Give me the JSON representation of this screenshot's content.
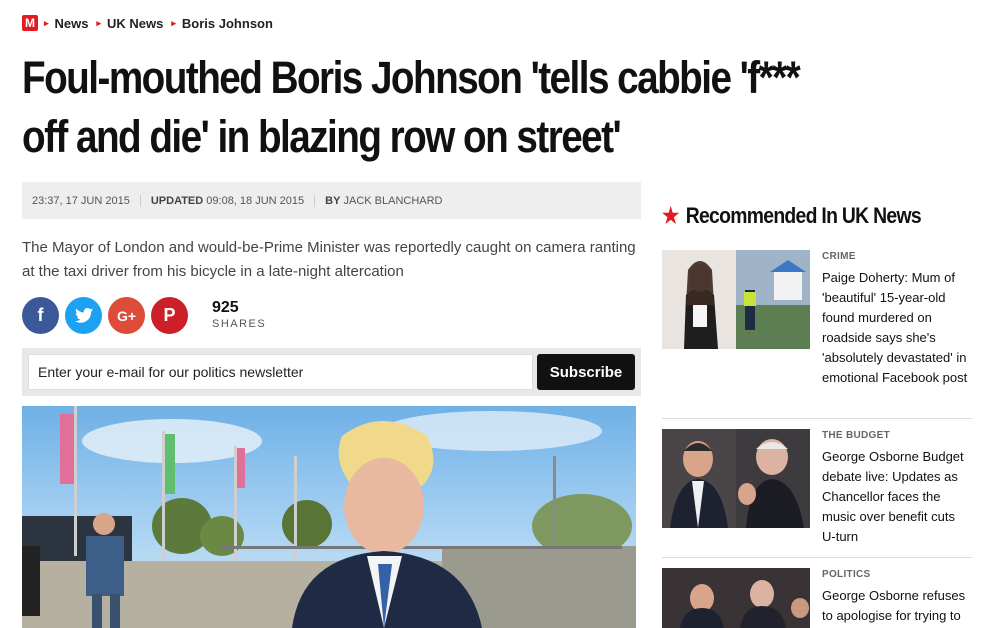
{
  "breadcrumb": {
    "logo": "M",
    "items": [
      "News",
      "UK News",
      "Boris Johnson"
    ]
  },
  "headline": "Foul-mouthed Boris Johnson 'tells cabbie 'f*** off and die' in blazing row on street'",
  "meta": {
    "published": "23:37, 17 JUN 2015",
    "updated_label": "UPDATED",
    "updated": "09:08, 18 JUN 2015",
    "by_label": "BY",
    "author": "JACK BLANCHARD"
  },
  "standfirst": "The Mayor of London and would-be-Prime Minister was reportedly caught on camera ranting at the taxi driver from his bicycle in a late-night altercation",
  "social": {
    "icons": [
      "facebook-icon",
      "twitter-icon",
      "google-plus-icon",
      "pinterest-icon"
    ],
    "share_count": "925",
    "share_label": "SHARES"
  },
  "newsletter": {
    "placeholder": "Enter your e-mail for our politics newsletter",
    "button": "Subscribe"
  },
  "sidebar": {
    "title": "Recommended In UK News",
    "cards": [
      {
        "category": "CRIME",
        "title": "Paige Doherty: Mum of 'beautiful' 15-year-old found murdered on roadside says she's 'absolutely devastated' in emotional Facebook post"
      },
      {
        "category": "THE BUDGET",
        "title": "George Osborne Budget debate live: Updates as Chancellor faces the music over benefit cuts U-turn"
      },
      {
        "category": "POLITICS",
        "title": "George Osborne refuses to apologise for trying to"
      }
    ]
  },
  "colors": {
    "accent": "#e21b23",
    "facebook": "#3b5998",
    "twitter": "#1da1f2",
    "google_plus": "#dd4b39",
    "pinterest": "#cb2027"
  }
}
